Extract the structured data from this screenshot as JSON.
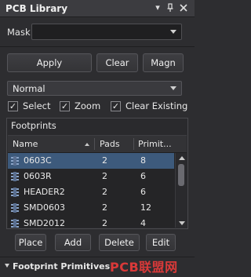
{
  "panel": {
    "title": "PCB Library"
  },
  "mask": {
    "label": "Mask",
    "value": "",
    "placeholder": ""
  },
  "actions": {
    "apply": "Apply",
    "clear": "Clear",
    "magnify": "Magn"
  },
  "view_mode": {
    "selected": "Normal"
  },
  "options": {
    "select": {
      "label": "Select",
      "checked": true
    },
    "zoom": {
      "label": "Zoom",
      "checked": true
    },
    "clear_existing": {
      "label": "Clear Existing",
      "checked": true
    }
  },
  "footprints": {
    "title": "Footprints",
    "columns": [
      "Name",
      "Pads",
      "Primitives"
    ],
    "columns_display": [
      "Name",
      "Pads",
      "Primit..."
    ],
    "rows": [
      {
        "name": "0603C",
        "pads": "2",
        "primitives": "8",
        "selected": true
      },
      {
        "name": "0603R",
        "pads": "2",
        "primitives": "6",
        "selected": false
      },
      {
        "name": "HEADER2",
        "pads": "2",
        "primitives": "6",
        "selected": false
      },
      {
        "name": "SMD0603",
        "pads": "2",
        "primitives": "12",
        "selected": false
      },
      {
        "name": "SMD2012",
        "pads": "2",
        "primitives": "4",
        "selected": false
      }
    ]
  },
  "footprint_actions": {
    "place": "Place",
    "add": "Add",
    "delete": "Delete",
    "edit": "Edit"
  },
  "primitives": {
    "title": "Footprint Primitives"
  },
  "watermark": "PCB联盟网",
  "colors": {
    "panel_bg": "#2d2d30",
    "selection": "#3d5a7c",
    "watermark": "#e43a3a"
  }
}
